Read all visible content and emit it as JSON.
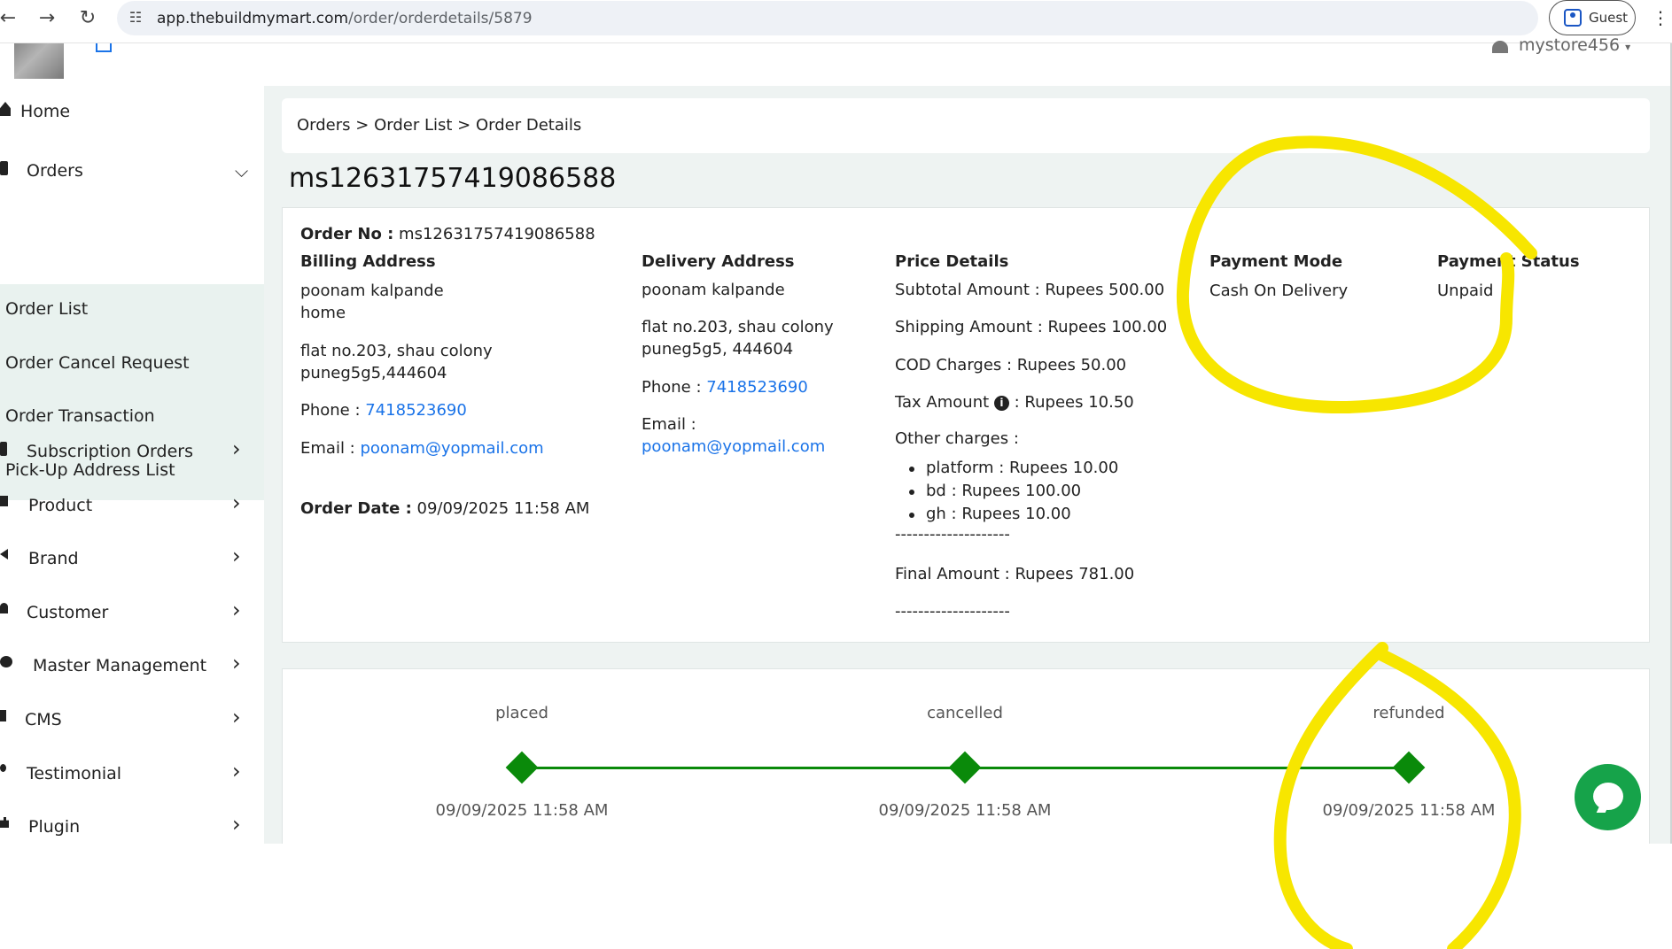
{
  "browser": {
    "url_host": "app.thebuildmymart.com",
    "url_path": "/order/orderdetails/5879",
    "profile_label": "Guest"
  },
  "header": {
    "user_name": "mystore456"
  },
  "sidebar": {
    "items": [
      {
        "label": "Home"
      },
      {
        "label": "Orders"
      },
      {
        "label": "Subscription Orders"
      },
      {
        "label": "Product"
      },
      {
        "label": "Brand"
      },
      {
        "label": "Customer"
      },
      {
        "label": "Master Management"
      },
      {
        "label": "CMS"
      },
      {
        "label": "Testimonial"
      },
      {
        "label": "Plugin"
      }
    ],
    "orders_sub": [
      {
        "label": "Order List"
      },
      {
        "label": "Order Cancel Request"
      },
      {
        "label": "Order Transaction"
      },
      {
        "label": "Pick-Up Address List"
      }
    ]
  },
  "breadcrumb": [
    "Orders",
    "Order List",
    "Order Details"
  ],
  "breadcrumb_sep": ">",
  "page_title": "ms12631757419086588",
  "order": {
    "order_no_label": "Order No :",
    "order_no": "ms12631757419086588",
    "billing": {
      "heading": "Billing Address",
      "name": "poonam kalpande",
      "line1": "home",
      "line2": "flat no.203, shau colony",
      "line3": "puneg5g5,444604",
      "phone_label": "Phone :",
      "phone": "7418523690",
      "email_label": "Email :",
      "email": "poonam@yopmail.com"
    },
    "order_date_label": "Order Date :",
    "order_date": "09/09/2025 11:58 AM",
    "delivery": {
      "heading": "Delivery Address",
      "name": "poonam kalpande",
      "line1": "flat no.203, shau colony",
      "line2": "puneg5g5, 444604",
      "phone_label": "Phone :",
      "phone": "7418523690",
      "email_label": "Email :",
      "email": "poonam@yopmail.com"
    },
    "price": {
      "heading": "Price Details",
      "subtotal": "Subtotal Amount : Rupees 500.00",
      "shipping": "Shipping Amount : Rupees 100.00",
      "cod": "COD Charges : Rupees  50.00",
      "tax_label": "Tax Amount",
      "tax_info": "i",
      "tax_value": ": Rupees  10.50",
      "other_heading": "Other charges :",
      "other": [
        {
          "text": "platform :  Rupees  10.00"
        },
        {
          "text": "bd :  Rupees  100.00"
        },
        {
          "text": "gh :  Rupees  10.00"
        }
      ],
      "divider1": "--------------------",
      "final": "Final Amount : Rupees  781.00",
      "divider2": "--------------------"
    },
    "payment_mode_heading": "Payment Mode",
    "payment_mode": "Cash On Delivery",
    "payment_status_heading": "Payment Status",
    "payment_status": "Unpaid"
  },
  "timeline": [
    {
      "label": "placed",
      "date": "09/09/2025 11:58 AM"
    },
    {
      "label": "cancelled",
      "date": "09/09/2025 11:58 AM"
    },
    {
      "label": "refunded",
      "date": "09/09/2025 11:58 AM"
    }
  ],
  "colors": {
    "timeline_green": "#0a8a0a",
    "link_blue": "#1a73e8",
    "annotation_yellow": "#f7e600",
    "chat_green": "#16a34a"
  }
}
